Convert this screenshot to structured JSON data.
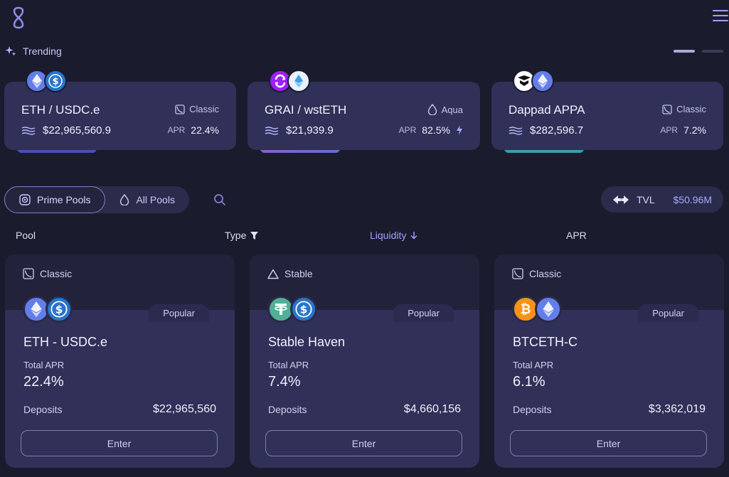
{
  "colors": {
    "background": "#1b1b2e",
    "card": "#303058",
    "accent": "#a6a9ff",
    "eth": "#627eea",
    "usdc": "#2775ca",
    "usdt": "#50af95",
    "btc": "#f7931a"
  },
  "header": {
    "logo_icon": "infinity-logo-icon",
    "menu_icon": "hamburger-menu-icon"
  },
  "trending": {
    "label": "Trending",
    "cards": [
      {
        "name": "ETH / USDC.e",
        "type": "Classic",
        "type_icon": "classic-curve-icon",
        "tvl": "$22,965,560.9",
        "apr_label": "APR",
        "apr": "22.4%",
        "boosted": false,
        "tokens": [
          "eth",
          "usdc"
        ]
      },
      {
        "name": "GRAI / wstETH",
        "type": "Aqua",
        "type_icon": "droplet-icon",
        "tvl": "$21,939.9",
        "apr_label": "APR",
        "apr": "82.5%",
        "boosted": true,
        "tokens": [
          "grai",
          "wsteth"
        ]
      },
      {
        "name": "Dappad APPA",
        "type": "Classic",
        "type_icon": "classic-curve-icon",
        "tvl": "$282,596.7",
        "apr_label": "APR",
        "apr": "7.2%",
        "boosted": false,
        "tokens": [
          "appa",
          "eth"
        ]
      }
    ]
  },
  "filters": {
    "prime_pools": "Prime Pools",
    "all_pools": "All Pools",
    "tvl_label": "TVL",
    "tvl_value": "$50.96M"
  },
  "columns": {
    "pool": "Pool",
    "type": "Type",
    "liquidity": "Liquidity",
    "apr": "APR"
  },
  "pools": [
    {
      "type": "Classic",
      "badge": "Popular",
      "name": "ETH - USDC.e",
      "apr_label": "Total APR",
      "apr": "22.4%",
      "deposits_label": "Deposits",
      "deposits": "$22,965,560",
      "enter": "Enter",
      "tokens": [
        "eth",
        "usdc"
      ]
    },
    {
      "type": "Stable",
      "badge": "Popular",
      "name": "Stable Haven",
      "apr_label": "Total APR",
      "apr": "7.4%",
      "deposits_label": "Deposits",
      "deposits": "$4,660,156",
      "enter": "Enter",
      "tokens": [
        "usdt",
        "usdc"
      ]
    },
    {
      "type": "Classic",
      "badge": "Popular",
      "name": "BTCETH-C",
      "apr_label": "Total APR",
      "apr": "6.1%",
      "deposits_label": "Deposits",
      "deposits": "$3,362,019",
      "enter": "Enter",
      "tokens": [
        "btc",
        "eth"
      ]
    }
  ]
}
